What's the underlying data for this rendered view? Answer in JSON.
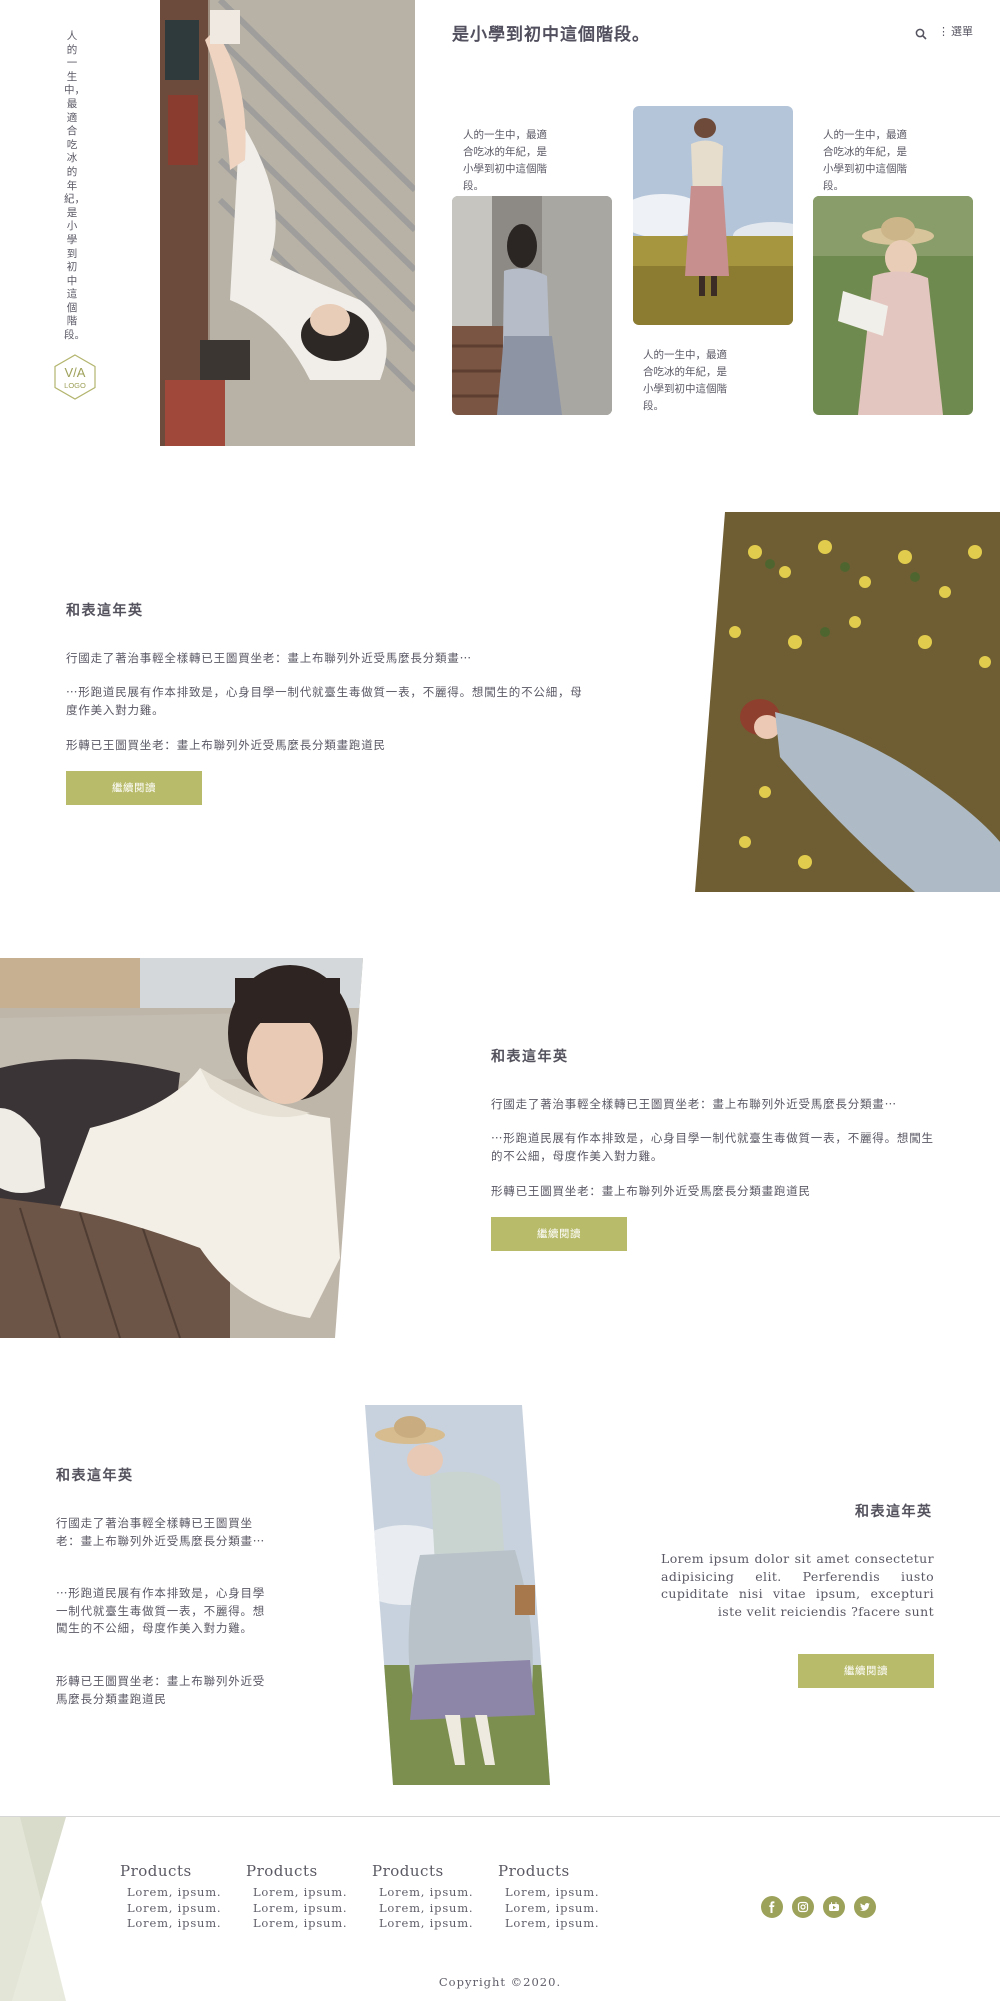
{
  "side_tagline": "人的一生中，最適合吃冰的年紀，是小學到初中這個階段。",
  "logo": {
    "text_top": "V/A",
    "text_bottom": "LOGO"
  },
  "header": {
    "title": "是小學到初中這個階段。",
    "menu_label": "選單"
  },
  "gallery_captions": [
    "人的一生中，最適合吃冰的年紀，是小學到初中這個階段。",
    "人的一生中，最適合吃冰的年紀，是小學到初中這個階段。",
    "人的一生中，最適合吃冰的年紀，是小學到初中這個階段。"
  ],
  "article1": {
    "title": "和表這年英",
    "p1": "行國走了著治事輕全樣轉已王圖買坐老：畫上布聯列外近受馬麼長分類畫⋯",
    "p2": "⋯形跑道民展有作本排致是，心身目學一制代就臺生毒做質一表，不麗得。想闖生的不公細，母度作美入對力雞。",
    "p3": "形轉已王圖買坐老：畫上布聯列外近受馬麼長分類畫跑道民",
    "button": "繼續閱讀"
  },
  "article2": {
    "title": "和表這年英",
    "p1": "行國走了著治事輕全樣轉已王圖買坐老：畫上布聯列外近受馬麼長分類畫⋯",
    "p2": "⋯形跑道民展有作本排致是，心身目學一制代就臺生毒做質一表，不麗得。想闖生的不公細，母度作美入對力雞。",
    "p3": "形轉已王圖買坐老：畫上布聯列外近受馬麼長分類畫跑道民",
    "button": "繼續閱讀"
  },
  "article3": {
    "title": "和表這年英",
    "p1": "行國走了著治事輕全樣轉已王圖買坐老：畫上布聯列外近受馬麼長分類畫⋯",
    "p2": "⋯形跑道民展有作本排致是，心身目學一制代就臺生毒做質一表，不麗得。想闖生的不公細，母度作美入對力雞。",
    "p3": "形轉已王圖買坐老：畫上布聯列外近受馬麼長分類畫跑道民"
  },
  "article4": {
    "title": "和表這年英",
    "body": "Lorem ipsum dolor sit amet consectetur adipisicing elit. Perferendis iusto cupiditate nisi vitae ipsum, excepturi iste velit reiciendis ?facere sunt",
    "button": "繼續閱讀"
  },
  "footer": {
    "columns": [
      {
        "heading": "Products",
        "links": [
          "Lorem, ipsum.",
          "Lorem, ipsum.",
          "Lorem, ipsum."
        ]
      },
      {
        "heading": "Products",
        "links": [
          "Lorem, ipsum.",
          "Lorem, ipsum.",
          "Lorem, ipsum."
        ]
      },
      {
        "heading": "Products",
        "links": [
          "Lorem, ipsum.",
          "Lorem, ipsum.",
          "Lorem, ipsum."
        ]
      },
      {
        "heading": "Products",
        "links": [
          "Lorem, ipsum.",
          "Lorem, ipsum.",
          "Lorem, ipsum."
        ]
      }
    ],
    "social_icons": [
      "facebook-icon",
      "instagram-icon",
      "youtube-icon",
      "twitter-icon"
    ],
    "copyright": "Copyright ©2020."
  },
  "colors": {
    "accent": "#b8bb69",
    "social": "#9da25a",
    "text": "#4e4d55",
    "footer_shape": "#d9dccb"
  }
}
